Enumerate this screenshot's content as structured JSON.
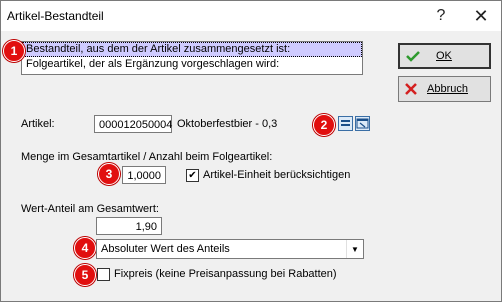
{
  "window": {
    "title": "Artikel-Bestandteil",
    "help_glyph": "?",
    "close_glyph": "✕"
  },
  "list": {
    "items": [
      {
        "label": "Bestandteil, aus dem der Artikel zusammengesetzt ist:",
        "selected": true
      },
      {
        "label": "Folgeartikel, der als Ergänzung vorgeschlagen wird:",
        "selected": false
      }
    ]
  },
  "badges": [
    "1",
    "2",
    "3",
    "4",
    "5"
  ],
  "artikel": {
    "label": "Artikel:",
    "number": "000012050004",
    "description": "Oktoberfestbier - 0,3"
  },
  "menge": {
    "label": "Menge im Gesamtartikel / Anzahl beim Folgeartikel:",
    "value": "1,0000",
    "checkbox_label": "Artikel-Einheit berücksichtigen",
    "checkbox_checked": true
  },
  "wert": {
    "label": "Wert-Anteil am Gesamtwert:",
    "value": "1,90",
    "dropdown_value": "Absoluter Wert des Anteils"
  },
  "fixpreis": {
    "label": "Fixpreis (keine Preisanpassung bei Rabatten)",
    "checked": false
  },
  "buttons": {
    "ok_label": "OK",
    "cancel_label": "Abbruch"
  },
  "colors": {
    "selection": "#cfcbff",
    "badge": "#e10f0f",
    "ok_check": "#2e9a2e",
    "cancel_x": "#d42020"
  }
}
